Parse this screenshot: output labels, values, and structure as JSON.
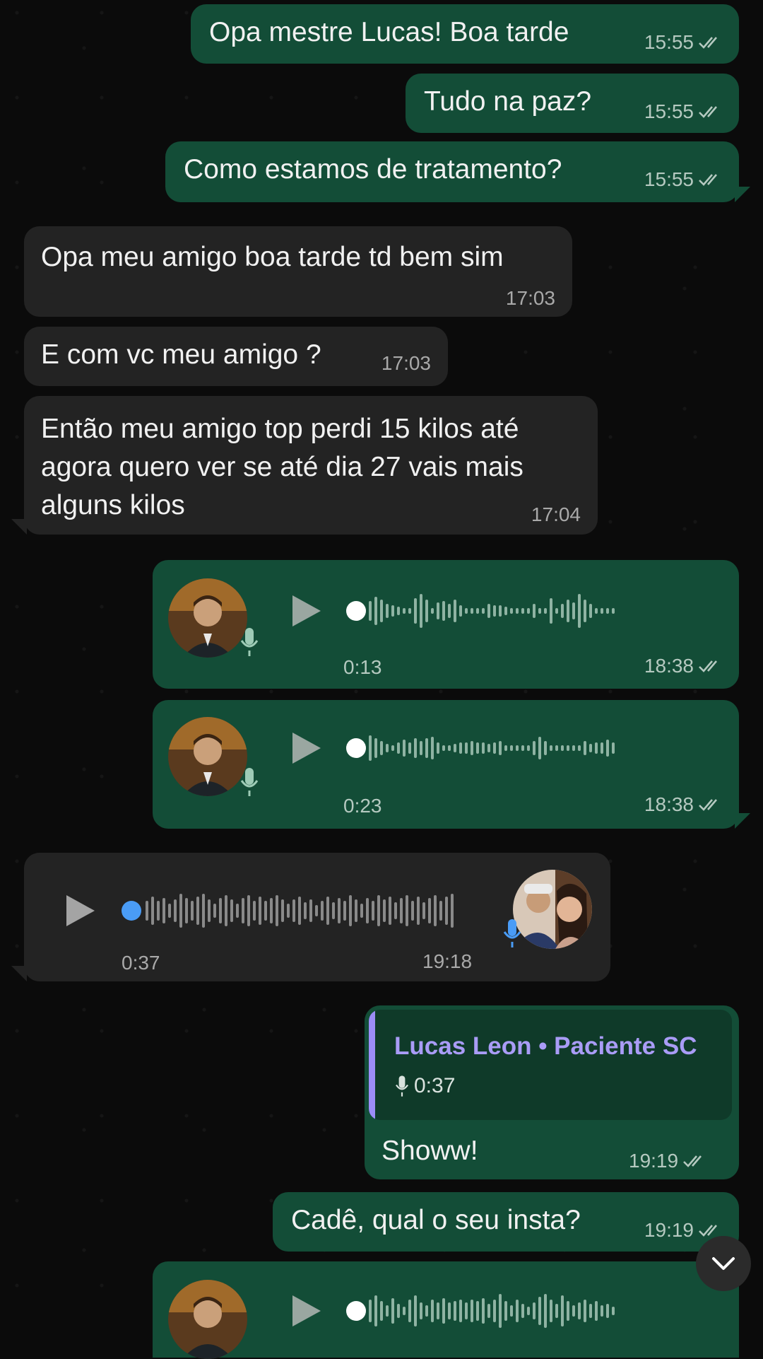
{
  "messages": [
    {
      "text": "Opa mestre Lucas! Boa tarde",
      "time": "15:55"
    },
    {
      "text": "Tudo na paz?",
      "time": "15:55"
    },
    {
      "text": "Como estamos de tratamento?",
      "time": "15:55"
    },
    {
      "text": "Opa meu amigo boa tarde td bem sim",
      "time": "17:03"
    },
    {
      "text": "E com vc meu amigo ?",
      "time": "17:03"
    },
    {
      "text": "Então meu amigo top perdi 15 kilos até\nagora quero ver se até dia 27 vais mais\nalguns kilos",
      "time": "17:04"
    },
    {
      "duration": "0:13",
      "time": "18:38"
    },
    {
      "duration": "0:23",
      "time": "18:38"
    },
    {
      "duration": "0:37",
      "time": "19:18"
    },
    {
      "quote_author": "Lucas Leon • Paciente SC",
      "quote_duration": "0:37",
      "text": "Showw!",
      "time": "19:19"
    },
    {
      "text": "Cadê, qual o seu insta?",
      "time": "19:19"
    },
    {
      "duration": "",
      "time": ""
    }
  ],
  "colors": {
    "outgoing_bubble": "#134d37",
    "incoming_bubble": "#232323",
    "quote_accent": "#9b8cf6",
    "unplayed_dot": "#4a9cf6"
  },
  "icons": [
    "double-check-icon",
    "play-icon",
    "mic-icon",
    "chevron-down-icon"
  ]
}
